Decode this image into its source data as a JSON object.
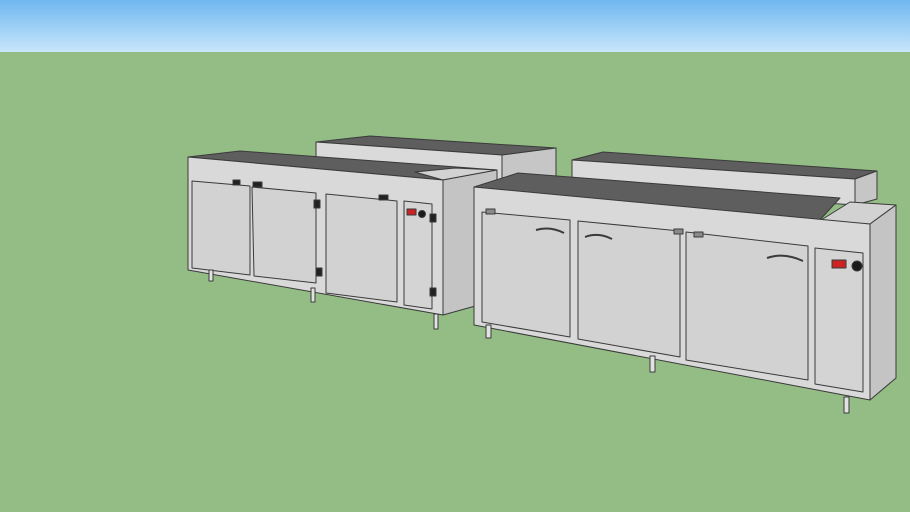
{
  "scene": {
    "sky_color_top": "#6fb7f0",
    "sky_color_bottom": "#c8e6fb",
    "ground_color": "#94bd86",
    "unit_body_color": "#d9d9d9",
    "unit_side_color": "#c4c4c4",
    "unit_top_color": "#5e5e5e",
    "outline_color": "#3a3a3a",
    "display_color": "#cc2222",
    "objects": [
      "back-counter-left",
      "front-counter-left",
      "back-counter-right",
      "front-counter-right"
    ]
  }
}
